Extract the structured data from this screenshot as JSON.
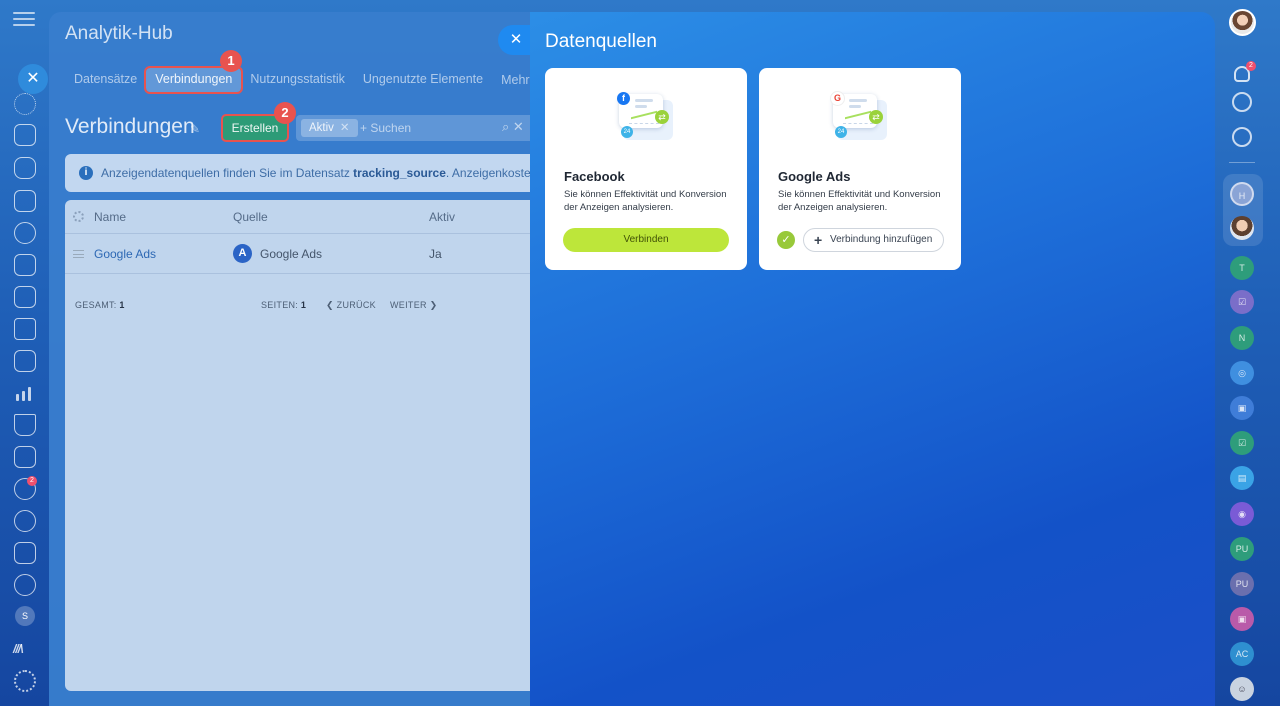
{
  "back_window": {
    "title": "Analytik-Hub",
    "tabs": [
      {
        "label": "Datensätze"
      },
      {
        "label": "Verbindungen"
      },
      {
        "label": "Nutzungsstatistik"
      },
      {
        "label": "Ungenutzte Elemente"
      },
      {
        "label": "Mehr ⌄"
      }
    ],
    "heading": "Verbindungen",
    "create_label": "Erstellen",
    "filter": {
      "chip": "Aktiv",
      "placeholder": "+ Suchen"
    },
    "info": {
      "prefix": "Anzeigendatenquellen finden Sie im Datensatz ",
      "dataset": "tracking_source",
      "suffix": ". Anzeigenkostenstatistik"
    },
    "table": {
      "headers": [
        "Name",
        "Quelle",
        "Aktiv"
      ],
      "rows": [
        {
          "name": "Google Ads",
          "source": "Google Ads",
          "active": "Ja"
        }
      ],
      "footer": {
        "total_label": "GESAMT:",
        "total_value": "1",
        "pages_label": "SEITEN:",
        "pages_value": "1",
        "prev": "❮ ZURÜCK",
        "next": "WEITER ❯"
      }
    },
    "step_badges": [
      "1",
      "2"
    ]
  },
  "slider": {
    "title": "Datenquellen",
    "cards": [
      {
        "name": "Facebook",
        "description": "Sie können Effektivität und Konversion der Anzeigen analysieren.",
        "button_label": "Verbinden",
        "brand_letter": "f"
      },
      {
        "name": "Google Ads",
        "description": "Sie können Effektivität und Konversion der Anzeigen analysieren.",
        "button_label": "Verbindung hinzufügen",
        "brand_letter": "G"
      }
    ],
    "illustration_badge": "24"
  },
  "right_bar": {
    "notification_count": "2",
    "avatars": [
      "H",
      "T",
      "N",
      "PU",
      "PU",
      "AC"
    ]
  },
  "left_bar": {
    "funnel_badge": "2",
    "user_initial": "S",
    "logo_text": "///\\"
  },
  "colors": {
    "accent_green": "#bde63a",
    "step_badge": "#e8534f",
    "create_button": "#2d9b77",
    "link_blue": "#2d68b4"
  }
}
